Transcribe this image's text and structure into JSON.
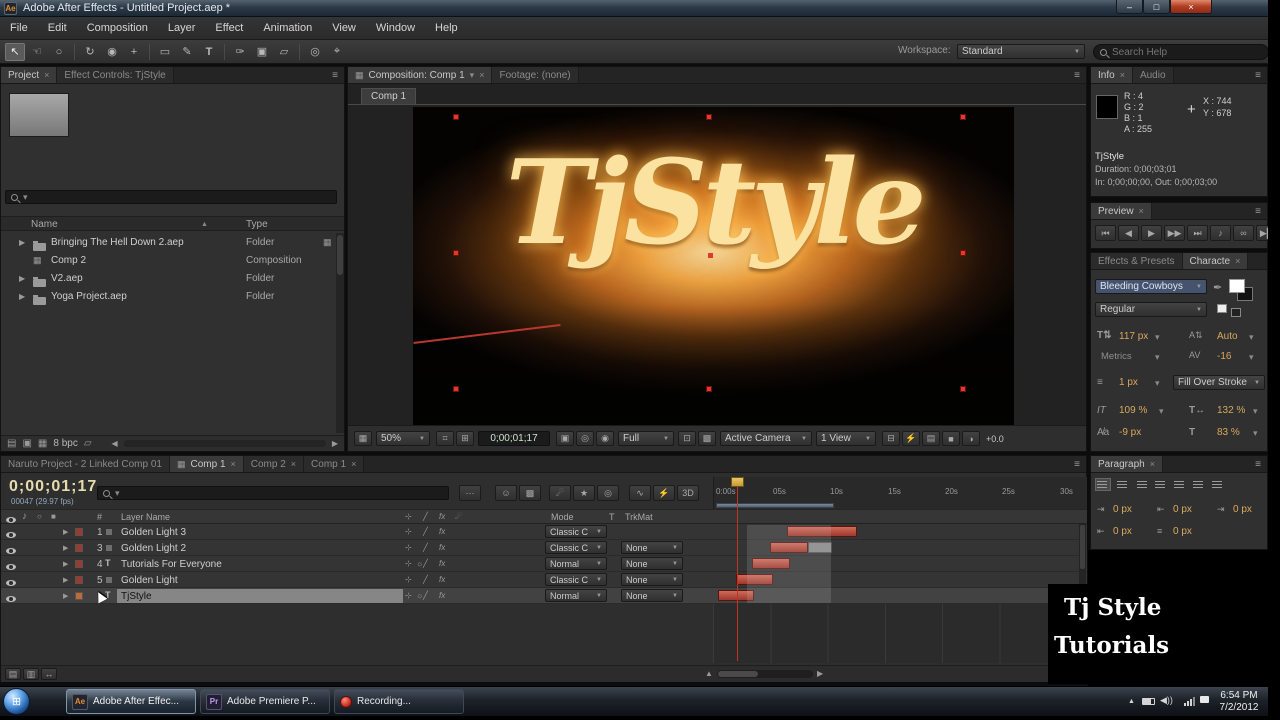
{
  "window": {
    "title": "Adobe After Effects - Untitled Project.aep *",
    "menus": [
      "File",
      "Edit",
      "Composition",
      "Layer",
      "Effect",
      "Animation",
      "View",
      "Window",
      "Help"
    ]
  },
  "toolbar": {
    "workspace_label": "Workspace:",
    "workspace_value": "Standard",
    "search_placeholder": "Search Help"
  },
  "project": {
    "tab1": "Project",
    "tab2": "Effect Controls: TjStyle",
    "col_name": "Name",
    "col_type": "Type",
    "items": [
      {
        "name": "Bringing The Hell Down 2.aep",
        "type": "Folder"
      },
      {
        "name": "Comp 2",
        "type": "Composition"
      },
      {
        "name": "V2.aep",
        "type": "Folder"
      },
      {
        "name": "Yoga Project.aep",
        "type": "Folder"
      }
    ],
    "bit_depth": "8 bpc"
  },
  "comp": {
    "tab1": "Composition: Comp 1",
    "tab2": "Footage: (none)",
    "subtab": "Comp 1",
    "canvas_text": "TjStyle",
    "zoom": "50%",
    "timecode": "0;00;01;17",
    "resolution": "Full",
    "camera": "Active Camera",
    "view": "1 View",
    "exposure": "+0.0"
  },
  "info": {
    "tab1": "Info",
    "tab2": "Audio",
    "r": "R : 4",
    "g": "G : 2",
    "b": "B : 1",
    "a": "A : 255",
    "x": "X : 744",
    "y": "Y : 678",
    "name": "TjStyle",
    "duration": "Duration: 0;00;03;01",
    "inout": "In: 0;00;00;00, Out: 0;00;03;00"
  },
  "preview": {
    "tab": "Preview"
  },
  "character": {
    "tab_fx": "Effects & Presets",
    "tab": "Characte",
    "font": "Bleeding Cowboys",
    "style": "Regular",
    "size": "117 px",
    "kerning": "Auto",
    "kern_mode": "Metrics",
    "tracking": "-16",
    "stroke": "1 px",
    "fill_order": "Fill Over Stroke",
    "vscale": "109 %",
    "hscale": "132 %",
    "baseline": "-9 px",
    "tsume": "83 %"
  },
  "paragraph": {
    "tab": "Paragraph",
    "v1": "0 px",
    "v2": "0 px",
    "v3": "0 px",
    "v4": "0 px",
    "v5": "0 px"
  },
  "timeline": {
    "tab0": "Naruto Project - 2 Linked Comp 01",
    "tab1": "Comp 1",
    "tab2": "Comp 2",
    "tab3": "Comp 1",
    "timecode": "0;00;01;17",
    "frames": "00047 (29.97 fps)",
    "col_layer": "Layer Name",
    "col_mode": "Mode",
    "col_t": "T",
    "col_trkmat": "TrkMat",
    "layers": [
      {
        "num": "1",
        "name": "Golden Light 3",
        "mode": "Classic C",
        "trkmat": ""
      },
      {
        "num": "3",
        "name": "Golden Light 2",
        "mode": "Classic C",
        "trkmat": "None"
      },
      {
        "num": "4",
        "name": "Tutorials For Everyone",
        "mode": "Normal",
        "trkmat": "None"
      },
      {
        "num": "5",
        "name": "Golden Light",
        "mode": "Classic C",
        "trkmat": "None"
      },
      {
        "num": "",
        "name": "TjStyle",
        "mode": "Normal",
        "trkmat": "None"
      }
    ],
    "ruler": [
      "0:00s",
      "05s",
      "10s",
      "15s",
      "20s",
      "25s",
      "30s"
    ]
  },
  "overlay": {
    "line1": "Tj Style",
    "line2": "Tutorials"
  },
  "taskbar": {
    "app1": "Adobe After Effec...",
    "app2": "Adobe Premiere P...",
    "app3": "Recording...",
    "time": "6:54 PM",
    "date": "7/2/2012"
  }
}
